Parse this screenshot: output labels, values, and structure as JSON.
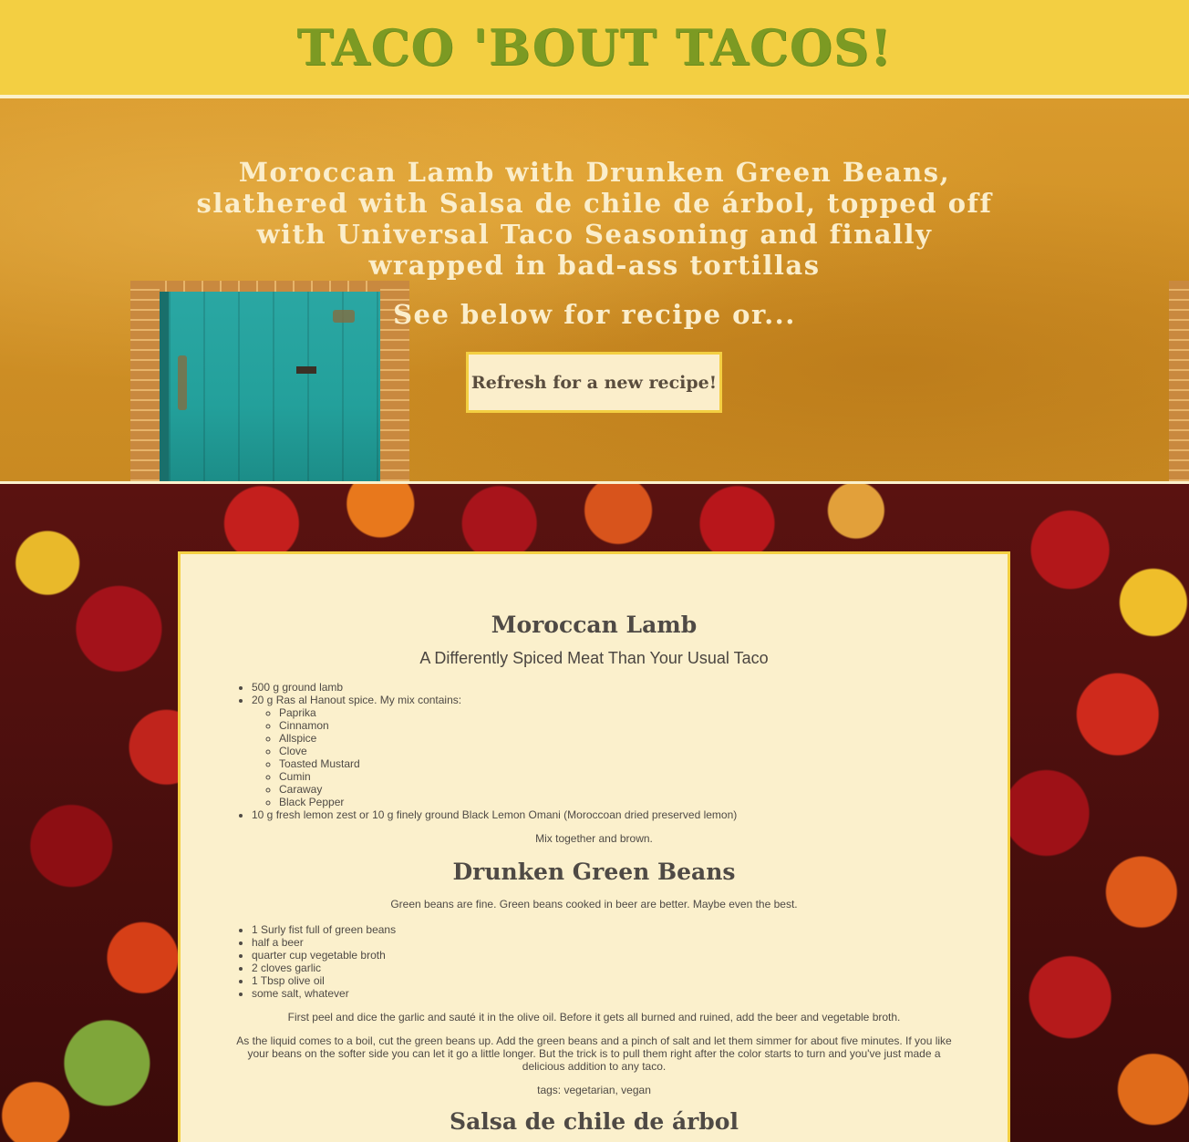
{
  "header": {
    "title": "TACO 'BOUT TACOS!"
  },
  "hero": {
    "title": "Moroccan Lamb with Drunken Green Beans, slathered with Salsa de chile de árbol, topped off with Universal Taco Seasoning and finally wrapped in bad-ass tortillas",
    "subtitle": "See below for recipe or...",
    "refresh_label": "Refresh for a new recipe!"
  },
  "recipe": {
    "main": {
      "title": "Moroccan Lamb",
      "subtitle": "A Differently Spiced Meat Than Your Usual Taco",
      "ingredients": [
        "500 g ground lamb",
        "20 g Ras al Hanout spice. My mix contains:",
        "10 g fresh lemon zest or 10 g finely ground Black Lemon Omani (Moroccoan dried preserved lemon)"
      ],
      "spices": [
        "Paprika",
        "Cinnamon",
        "Allspice",
        "Clove",
        "Toasted Mustard",
        "Cumin",
        "Caraway",
        "Black Pepper"
      ],
      "method": "Mix together and brown."
    },
    "side": {
      "title": "Drunken Green Beans",
      "intro": "Green beans are fine. Green beans cooked in beer are better. Maybe even the best.",
      "ingredients": [
        "1 Surly fist full of green beans",
        "half a beer",
        "quarter cup vegetable broth",
        "2 cloves garlic",
        "1 Tbsp olive oil",
        "some salt, whatever"
      ],
      "step1": "First peel and dice the garlic and sauté it in the olive oil. Before it gets all burned and ruined, add the beer and vegetable broth.",
      "step2": "As the liquid comes to a boil, cut the green beans up. Add the green beans and a pinch of salt and let them simmer for about five minutes. If you like your beans on the softer side you can let it go a little longer. But the trick is to pull them right after the color starts to turn and you've just made a delicious addition to any taco.",
      "tags": "tags: vegetarian, vegan"
    },
    "salsa": {
      "title": "Salsa de chile de árbol"
    }
  }
}
